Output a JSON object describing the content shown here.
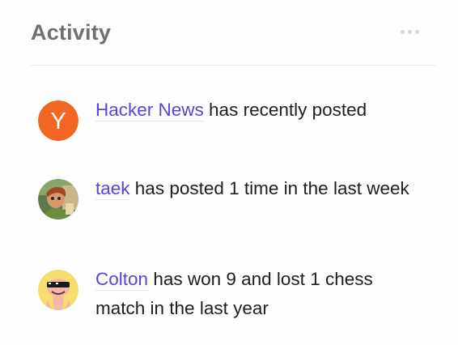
{
  "header": {
    "title": "Activity",
    "more_icon": "more-horizontal-icon"
  },
  "colors": {
    "link": "#5b44d6",
    "title": "#6f6f6f",
    "hn_orange": "#f26522"
  },
  "activities": [
    {
      "user": "Hacker News",
      "text": "has recently posted",
      "avatar_icon": "hacker-news-logo",
      "avatar_letter": "Y"
    },
    {
      "user": "taek",
      "text": "has posted 1 time in the last week",
      "avatar_icon": "cartoon-avatar"
    },
    {
      "user": "Colton",
      "text": "has won 9 and lost 1 chess match in the last year",
      "avatar_icon": "cartoon-avatar"
    }
  ]
}
